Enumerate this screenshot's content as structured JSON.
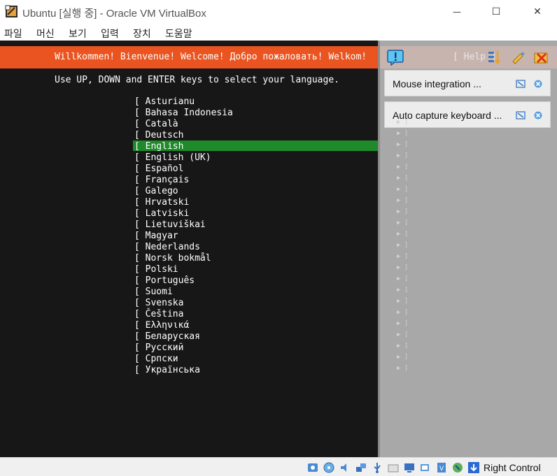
{
  "window": {
    "title": "Ubuntu [실행 중] - Oracle VM VirtualBox",
    "minimize_glyph": "—",
    "maximize_glyph": "☐",
    "close_glyph": "✕"
  },
  "menu": [
    "파일",
    "머신",
    "보기",
    "입력",
    "장치",
    "도움말"
  ],
  "installer": {
    "banner": "Willkommen! Bienvenue! Welcome! Добро пожаловать! Welkom!",
    "help_label": "[ Help ]",
    "instruction": "Use UP, DOWN and ENTER keys to select your language.",
    "selected_index": 4,
    "languages": [
      "[ Asturianu",
      "[ Bahasa Indonesia",
      "[ Català",
      "[ Deutsch",
      "[ English",
      "[ English (UK)",
      "[ Español",
      "[ Français",
      "[ Galego",
      "[ Hrvatski",
      "[ Latviski",
      "[ Lietuviškai",
      "[ Magyar",
      "[ Nederlands",
      "[ Norsk bokmål",
      "[ Polski",
      "[ Português",
      "[ Suomi",
      "[ Svenska",
      "[ Čeština",
      "[ Ελληνικά",
      "[ Беларуская",
      "[ Русский",
      "[ Српски",
      "[ Українська"
    ],
    "row_arrow": "▶ ]"
  },
  "notifications": [
    {
      "text": "Mouse integration ..."
    },
    {
      "text": "Auto capture keyboard ..."
    }
  ],
  "statusbar": {
    "host_key": "Right Control"
  },
  "colors": {
    "banner": "#e95420",
    "selection": "#1e8a2a",
    "terminal_bg": "#171717"
  }
}
